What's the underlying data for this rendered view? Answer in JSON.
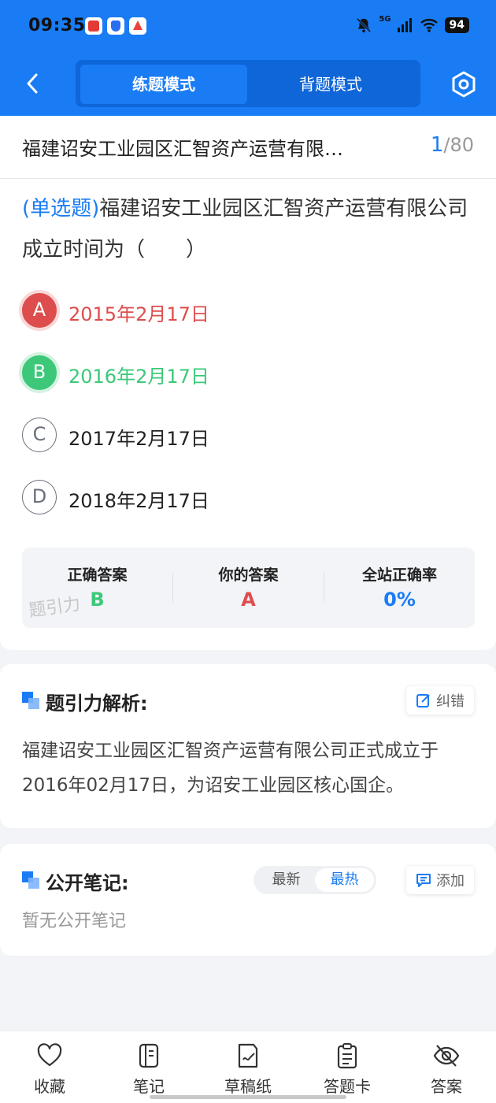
{
  "status_bar": {
    "time": "09:35",
    "network": "5G",
    "battery": "94"
  },
  "header": {
    "tabs": [
      {
        "label": "练题模式",
        "active": true
      },
      {
        "label": "背题模式",
        "active": false
      }
    ]
  },
  "question": {
    "title": "福建诏安工业园区汇智资产运营有限…",
    "current": "1",
    "total": "/80",
    "type_label": "(单选题)",
    "text": "福建诏安工业园区汇智资产运营有限公司成立时间为（　　）",
    "options": [
      {
        "letter": "A",
        "text": "2015年2月17日",
        "state": "wrong"
      },
      {
        "letter": "B",
        "text": "2016年2月17日",
        "state": "correct"
      },
      {
        "letter": "C",
        "text": "2017年2月17日",
        "state": "normal"
      },
      {
        "letter": "D",
        "text": "2018年2月17日",
        "state": "normal"
      }
    ]
  },
  "stats": {
    "correct_label": "正确答案",
    "correct_value": "B",
    "yours_label": "你的答案",
    "yours_value": "A",
    "rate_label": "全站正确率",
    "rate_value": "0%",
    "watermark": "题引力"
  },
  "analysis": {
    "title": "题引力解析:",
    "fix_button": "纠错",
    "text": "福建诏安工业园区汇智资产运营有限公司正式成立于2016年02月17日，为诏安工业园区核心国企。"
  },
  "notes": {
    "title": "公开笔记:",
    "sort_latest": "最新",
    "sort_hot": "最热",
    "add_button": "添加",
    "empty": "暂无公开笔记"
  },
  "bottom_bar": [
    {
      "label": "收藏",
      "icon": "heart-icon"
    },
    {
      "label": "笔记",
      "icon": "notebook-icon"
    },
    {
      "label": "草稿纸",
      "icon": "draft-icon"
    },
    {
      "label": "答题卡",
      "icon": "answer-sheet-icon"
    },
    {
      "label": "答案",
      "icon": "eye-off-icon"
    }
  ],
  "colors": {
    "primary": "#1a7cf5",
    "wrong": "#de4d4d",
    "correct": "#3cc878"
  }
}
